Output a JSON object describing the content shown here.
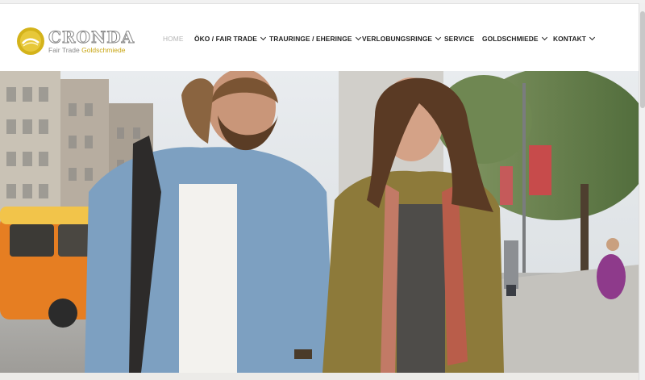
{
  "logo": {
    "brand": "CRONDA",
    "tagline_part1": "Fair Trade",
    "tagline_part2": "Goldschmiede"
  },
  "nav": {
    "items": [
      {
        "label": "HOME",
        "dropdown": false,
        "active": true
      },
      {
        "label": "ÖKO / FAIR TRADE",
        "dropdown": true
      },
      {
        "label": "TRAURINGE / EHERINGE",
        "dropdown": true
      },
      {
        "label": "VERLOBUNGSRINGE",
        "dropdown": true
      },
      {
        "label": "SERVICE",
        "dropdown": false
      },
      {
        "label": "GOLDSCHMIEDE",
        "dropdown": true
      },
      {
        "label": "KONTAKT",
        "dropdown": true
      }
    ]
  },
  "colors": {
    "accent_gold": "#c8a512",
    "nav_text": "#222222",
    "nav_active": "#b5b5b5"
  },
  "hero": {
    "image": "laughing-couple-walking-street"
  }
}
